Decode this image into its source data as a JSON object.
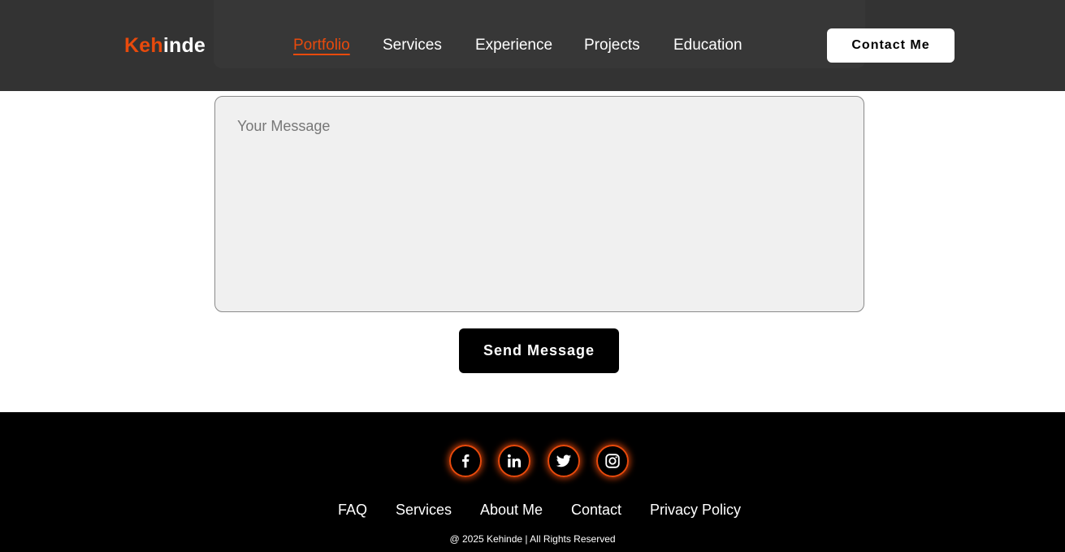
{
  "header": {
    "logo": {
      "accent": "Keh",
      "rest": "inde"
    },
    "nav": [
      {
        "label": "Portfolio",
        "active": true
      },
      {
        "label": "Services",
        "active": false
      },
      {
        "label": "Experience",
        "active": false
      },
      {
        "label": "Projects",
        "active": false
      },
      {
        "label": "Education",
        "active": false
      }
    ],
    "contact_label": "Contact Me"
  },
  "form": {
    "message_placeholder": "Your Message",
    "message_value": "",
    "send_label": "Send Message"
  },
  "footer": {
    "social": [
      {
        "icon": "facebook-icon"
      },
      {
        "icon": "linkedin-icon"
      },
      {
        "icon": "twitter-icon"
      },
      {
        "icon": "instagram-icon"
      }
    ],
    "links": [
      "FAQ",
      "Services",
      "About Me",
      "Contact",
      "Privacy Policy"
    ],
    "copyright": "@ 2025 Kehinde | All Rights Reserved"
  },
  "colors": {
    "accent": "#e84a0c",
    "header_bg": "#333333",
    "footer_bg": "#000000",
    "input_bg": "#f0f0f0"
  }
}
